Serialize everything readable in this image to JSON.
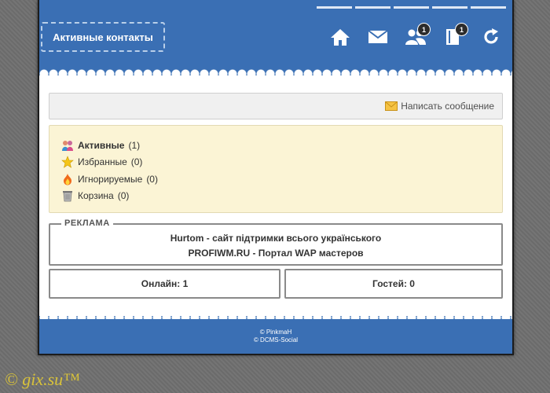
{
  "header": {
    "title": "Активные контакты",
    "nav": [
      {
        "icon": "home-icon"
      },
      {
        "icon": "mail-icon"
      },
      {
        "icon": "users-icon",
        "badge": "1"
      },
      {
        "icon": "book-icon",
        "badge": "1"
      },
      {
        "icon": "refresh-icon"
      }
    ]
  },
  "message_link": "Написать сообщение",
  "folders": [
    {
      "icon": "contacts-icon",
      "name": "Активные",
      "count": "(1)",
      "active": true
    },
    {
      "icon": "star-icon",
      "name": "Избранные",
      "count": "(0)"
    },
    {
      "icon": "fire-icon",
      "name": "Игнорируемые",
      "count": "(0)"
    },
    {
      "icon": "trash-icon",
      "name": "Корзина",
      "count": "(0)"
    }
  ],
  "ads": {
    "legend": "РЕКЛАМА",
    "lines": [
      "Hurtom - сайт підтримки всього українського",
      "PROFIWM.RU - Портал WAP мастеров"
    ]
  },
  "stats": {
    "online": "Онлайн: 1",
    "guests": "Гостей: 0"
  },
  "footer": {
    "line1": "© PinkmaH",
    "line2": "© DCMS-Social"
  },
  "watermark": "© gix.su™",
  "colors": {
    "header": "#3a6fb4",
    "menu_bg": "#fbf4d5",
    "watermark": "#d8c23a"
  }
}
